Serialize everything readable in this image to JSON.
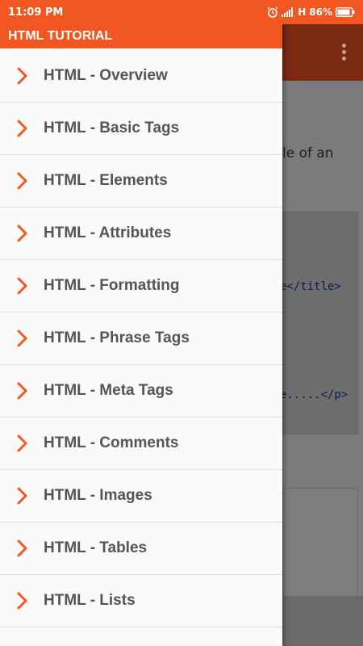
{
  "status_bar": {
    "time": "11:09 PM",
    "network": "H",
    "battery": "86%"
  },
  "drawer": {
    "title": "HTML TUTORIAL",
    "items": [
      {
        "label": "HTML - Overview"
      },
      {
        "label": "HTML - Basic Tags"
      },
      {
        "label": "HTML - Elements"
      },
      {
        "label": "HTML - Attributes"
      },
      {
        "label": "HTML - Formatting"
      },
      {
        "label": "HTML - Phrase Tags"
      },
      {
        "label": "HTML - Meta Tags"
      },
      {
        "label": "HTML - Comments"
      },
      {
        "label": "HTML - Images"
      },
      {
        "label": "HTML - Tables"
      },
      {
        "label": "HTML - Lists"
      }
    ]
  },
  "background": {
    "text_fragment": "le of an",
    "code_line_1": "e</title>",
    "code_line_2": "e.....</p>"
  },
  "colors": {
    "accent": "#f25621",
    "dark_accent": "#7a2a10",
    "item_text": "#555555"
  }
}
